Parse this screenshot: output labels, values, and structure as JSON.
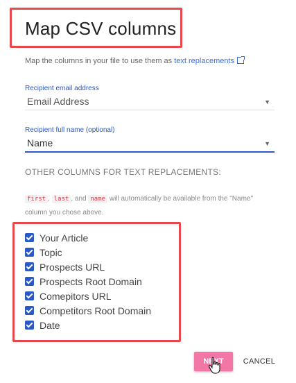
{
  "title": "Map CSV columns",
  "description": {
    "text": "Map the columns in your file to use them as ",
    "link": "text replacements"
  },
  "email_field": {
    "label": "Recipient email address",
    "value": "Email Address"
  },
  "name_field": {
    "label": "Recipient full name (optional)",
    "value": "Name"
  },
  "section_heading": "OTHER COLUMNS FOR TEXT REPLACEMENTS:",
  "note": {
    "code1": "first",
    "sep1": ", ",
    "code2": "last",
    "sep2": ", and ",
    "code3": "name",
    "text": " will automatically be available from the \"Name\" column you chose above."
  },
  "columns": [
    {
      "label": "Your Article",
      "checked": true
    },
    {
      "label": "Topic",
      "checked": true
    },
    {
      "label": "Prospects URL",
      "checked": true
    },
    {
      "label": "Prospects Root Domain",
      "checked": true
    },
    {
      "label": "Comepitors URL",
      "checked": true
    },
    {
      "label": "Competitors Root Domain",
      "checked": true
    },
    {
      "label": "Date",
      "checked": true
    }
  ],
  "buttons": {
    "next": "NEXT",
    "cancel": "CANCEL"
  },
  "colors": {
    "accent": "#2a58c4",
    "highlight": "#e8484c",
    "next_button": "#f277a6"
  }
}
